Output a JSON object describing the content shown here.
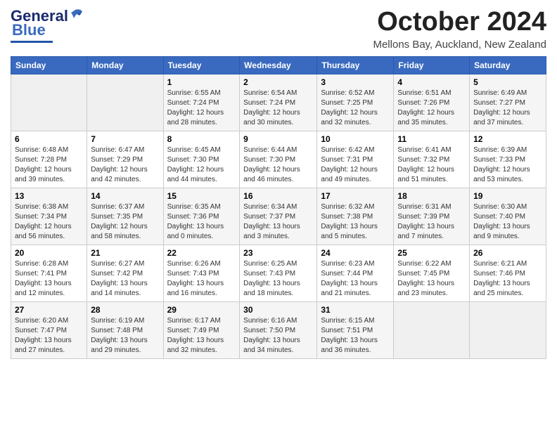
{
  "logo": {
    "line1": "General",
    "line2": "Blue"
  },
  "title": "October 2024",
  "location": "Mellons Bay, Auckland, New Zealand",
  "weekdays": [
    "Sunday",
    "Monday",
    "Tuesday",
    "Wednesday",
    "Thursday",
    "Friday",
    "Saturday"
  ],
  "weeks": [
    [
      {
        "day": "",
        "detail": ""
      },
      {
        "day": "",
        "detail": ""
      },
      {
        "day": "1",
        "detail": "Sunrise: 6:55 AM\nSunset: 7:24 PM\nDaylight: 12 hours\nand 28 minutes."
      },
      {
        "day": "2",
        "detail": "Sunrise: 6:54 AM\nSunset: 7:24 PM\nDaylight: 12 hours\nand 30 minutes."
      },
      {
        "day": "3",
        "detail": "Sunrise: 6:52 AM\nSunset: 7:25 PM\nDaylight: 12 hours\nand 32 minutes."
      },
      {
        "day": "4",
        "detail": "Sunrise: 6:51 AM\nSunset: 7:26 PM\nDaylight: 12 hours\nand 35 minutes."
      },
      {
        "day": "5",
        "detail": "Sunrise: 6:49 AM\nSunset: 7:27 PM\nDaylight: 12 hours\nand 37 minutes."
      }
    ],
    [
      {
        "day": "6",
        "detail": "Sunrise: 6:48 AM\nSunset: 7:28 PM\nDaylight: 12 hours\nand 39 minutes."
      },
      {
        "day": "7",
        "detail": "Sunrise: 6:47 AM\nSunset: 7:29 PM\nDaylight: 12 hours\nand 42 minutes."
      },
      {
        "day": "8",
        "detail": "Sunrise: 6:45 AM\nSunset: 7:30 PM\nDaylight: 12 hours\nand 44 minutes."
      },
      {
        "day": "9",
        "detail": "Sunrise: 6:44 AM\nSunset: 7:30 PM\nDaylight: 12 hours\nand 46 minutes."
      },
      {
        "day": "10",
        "detail": "Sunrise: 6:42 AM\nSunset: 7:31 PM\nDaylight: 12 hours\nand 49 minutes."
      },
      {
        "day": "11",
        "detail": "Sunrise: 6:41 AM\nSunset: 7:32 PM\nDaylight: 12 hours\nand 51 minutes."
      },
      {
        "day": "12",
        "detail": "Sunrise: 6:39 AM\nSunset: 7:33 PM\nDaylight: 12 hours\nand 53 minutes."
      }
    ],
    [
      {
        "day": "13",
        "detail": "Sunrise: 6:38 AM\nSunset: 7:34 PM\nDaylight: 12 hours\nand 56 minutes."
      },
      {
        "day": "14",
        "detail": "Sunrise: 6:37 AM\nSunset: 7:35 PM\nDaylight: 12 hours\nand 58 minutes."
      },
      {
        "day": "15",
        "detail": "Sunrise: 6:35 AM\nSunset: 7:36 PM\nDaylight: 13 hours\nand 0 minutes."
      },
      {
        "day": "16",
        "detail": "Sunrise: 6:34 AM\nSunset: 7:37 PM\nDaylight: 13 hours\nand 3 minutes."
      },
      {
        "day": "17",
        "detail": "Sunrise: 6:32 AM\nSunset: 7:38 PM\nDaylight: 13 hours\nand 5 minutes."
      },
      {
        "day": "18",
        "detail": "Sunrise: 6:31 AM\nSunset: 7:39 PM\nDaylight: 13 hours\nand 7 minutes."
      },
      {
        "day": "19",
        "detail": "Sunrise: 6:30 AM\nSunset: 7:40 PM\nDaylight: 13 hours\nand 9 minutes."
      }
    ],
    [
      {
        "day": "20",
        "detail": "Sunrise: 6:28 AM\nSunset: 7:41 PM\nDaylight: 13 hours\nand 12 minutes."
      },
      {
        "day": "21",
        "detail": "Sunrise: 6:27 AM\nSunset: 7:42 PM\nDaylight: 13 hours\nand 14 minutes."
      },
      {
        "day": "22",
        "detail": "Sunrise: 6:26 AM\nSunset: 7:43 PM\nDaylight: 13 hours\nand 16 minutes."
      },
      {
        "day": "23",
        "detail": "Sunrise: 6:25 AM\nSunset: 7:43 PM\nDaylight: 13 hours\nand 18 minutes."
      },
      {
        "day": "24",
        "detail": "Sunrise: 6:23 AM\nSunset: 7:44 PM\nDaylight: 13 hours\nand 21 minutes."
      },
      {
        "day": "25",
        "detail": "Sunrise: 6:22 AM\nSunset: 7:45 PM\nDaylight: 13 hours\nand 23 minutes."
      },
      {
        "day": "26",
        "detail": "Sunrise: 6:21 AM\nSunset: 7:46 PM\nDaylight: 13 hours\nand 25 minutes."
      }
    ],
    [
      {
        "day": "27",
        "detail": "Sunrise: 6:20 AM\nSunset: 7:47 PM\nDaylight: 13 hours\nand 27 minutes."
      },
      {
        "day": "28",
        "detail": "Sunrise: 6:19 AM\nSunset: 7:48 PM\nDaylight: 13 hours\nand 29 minutes."
      },
      {
        "day": "29",
        "detail": "Sunrise: 6:17 AM\nSunset: 7:49 PM\nDaylight: 13 hours\nand 32 minutes."
      },
      {
        "day": "30",
        "detail": "Sunrise: 6:16 AM\nSunset: 7:50 PM\nDaylight: 13 hours\nand 34 minutes."
      },
      {
        "day": "31",
        "detail": "Sunrise: 6:15 AM\nSunset: 7:51 PM\nDaylight: 13 hours\nand 36 minutes."
      },
      {
        "day": "",
        "detail": ""
      },
      {
        "day": "",
        "detail": ""
      }
    ]
  ]
}
